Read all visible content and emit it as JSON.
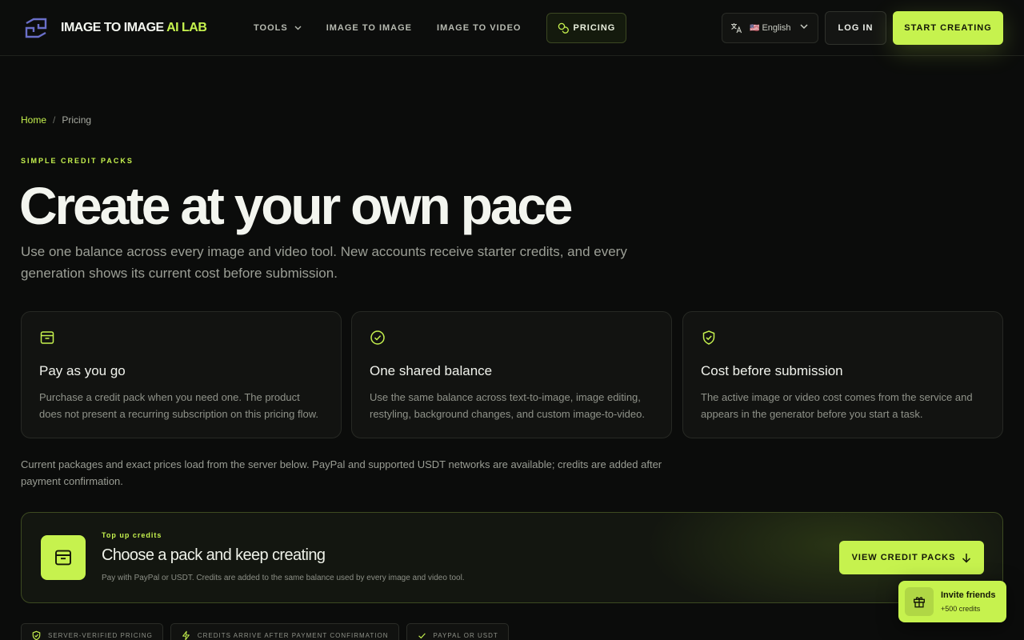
{
  "header": {
    "logo_main": "IMAGE TO IMAGE",
    "logo_accent": "AI LAB",
    "nav": {
      "tools": "TOOLS",
      "image_to_image": "IMAGE TO IMAGE",
      "image_to_video": "IMAGE TO VIDEO",
      "pricing": "PRICING"
    },
    "language": {
      "flag": "🇺🇸",
      "label": "English"
    },
    "login": "LOG IN",
    "start": "START CREATING"
  },
  "breadcrumb": {
    "home": "Home",
    "separator": "/",
    "current": "Pricing"
  },
  "hero": {
    "eyebrow": "SIMPLE CREDIT PACKS",
    "title": "Create at your own pace",
    "subtitle": "Use one balance across every image and video tool. New accounts receive starter credits, and every generation shows its current cost before submission."
  },
  "features": [
    {
      "icon": "archive-box-icon",
      "title": "Pay as you go",
      "text": "Purchase a credit pack when you need one. The product does not present a recurring subscription on this pricing flow."
    },
    {
      "icon": "check-circle-icon",
      "title": "One shared balance",
      "text": "Use the same balance across text-to-image, image editing, restyling, background changes, and custom image-to-video."
    },
    {
      "icon": "shield-check-icon",
      "title": "Cost before submission",
      "text": "The active image or video cost comes from the service and appears in the generator before you start a task."
    }
  ],
  "note": "Current packages and exact prices load from the server below. PayPal and supported USDT networks are available; credits are added after payment confirmation.",
  "topup": {
    "eyebrow": "Top up credits",
    "title": "Choose a pack and keep creating",
    "subtitle": "Pay with PayPal or USDT. Credits are added to the same balance used by every image and video tool.",
    "button": "VIEW CREDIT PACKS"
  },
  "pills": [
    "SERVER-VERIFIED PRICING",
    "CREDITS ARRIVE AFTER PAYMENT CONFIRMATION",
    "PAYPAL OR USDT"
  ],
  "invite": {
    "title": "Invite friends",
    "subtitle": "+500 credits"
  },
  "colors": {
    "accent": "#c6f24e",
    "background": "#0b0c0b",
    "card": "#121311"
  }
}
